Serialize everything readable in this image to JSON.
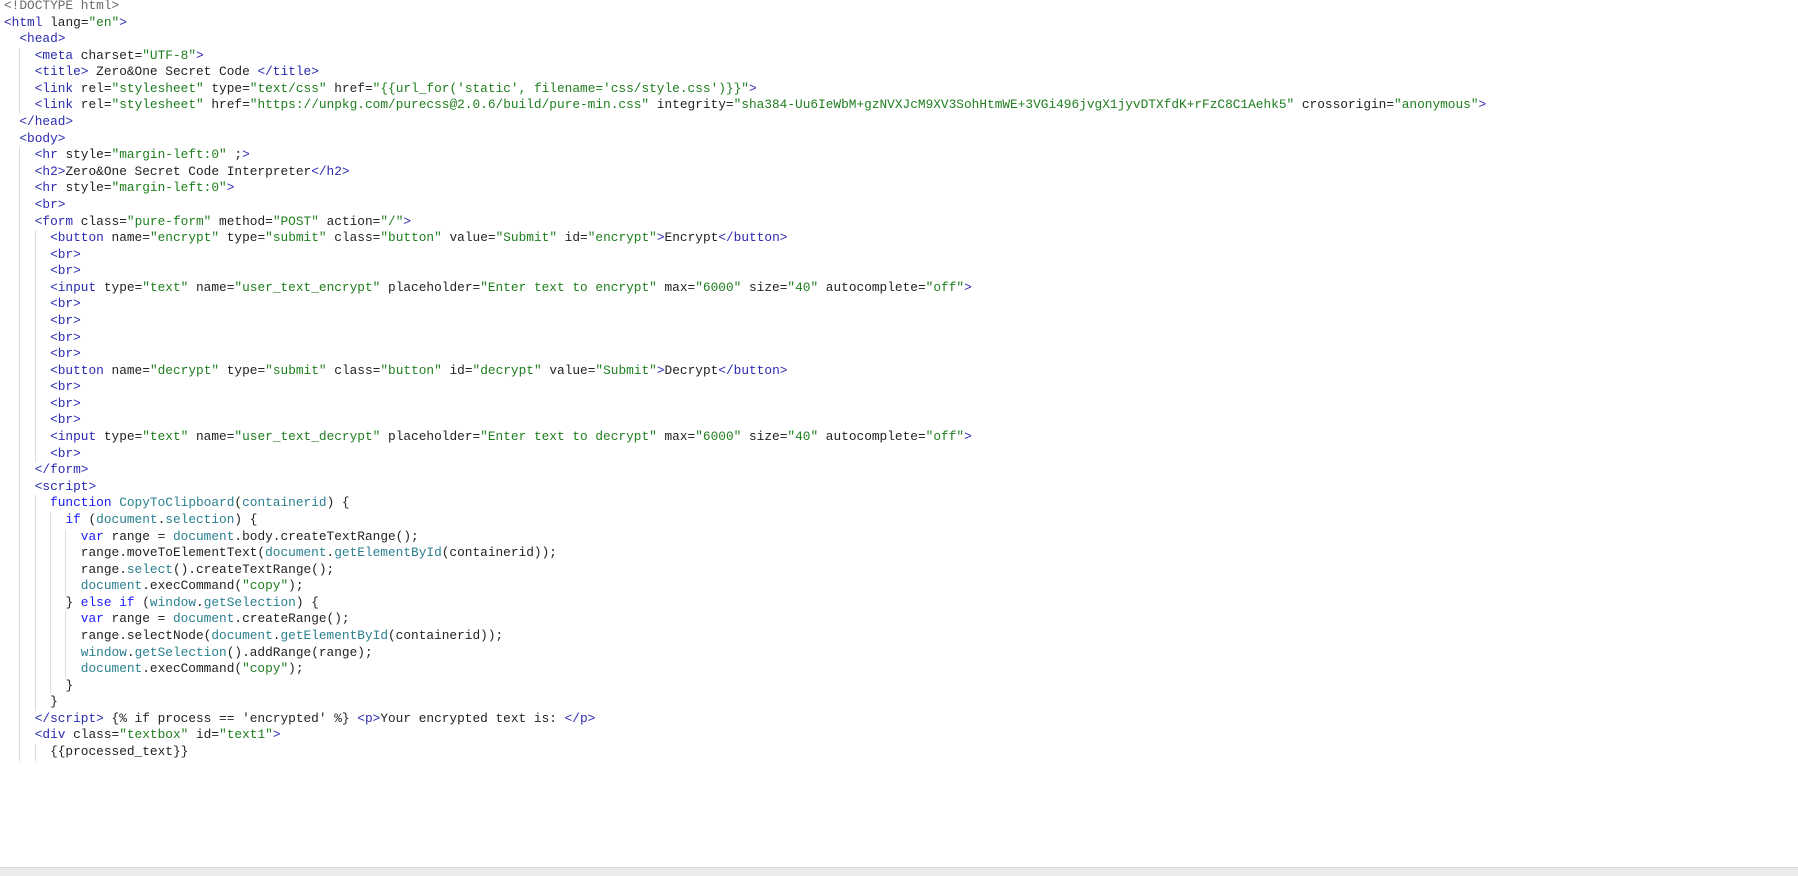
{
  "lines": [
    {
      "i": 0,
      "t": [
        [
          "dt",
          "<!DOCTYPE html>"
        ]
      ]
    },
    {
      "i": 0,
      "t": [
        [
          "p",
          "<html"
        ],
        [
          "a",
          " lang"
        ],
        [
          "x",
          "="
        ],
        [
          "s",
          "\"en\""
        ],
        [
          "p",
          ">"
        ]
      ]
    },
    {
      "i": 1,
      "t": [
        [
          "p",
          "<head>"
        ]
      ]
    },
    {
      "i": 2,
      "t": [
        [
          "p",
          "<meta"
        ],
        [
          "a",
          " charset"
        ],
        [
          "x",
          "="
        ],
        [
          "s",
          "\"UTF-8\""
        ],
        [
          "p",
          ">"
        ]
      ]
    },
    {
      "i": 2,
      "t": [
        [
          "p",
          "<title>"
        ],
        [
          "x",
          " Zero&One Secret Code "
        ],
        [
          "p",
          "</title>"
        ]
      ]
    },
    {
      "i": 2,
      "t": [
        [
          "p",
          "<link"
        ],
        [
          "a",
          " rel"
        ],
        [
          "x",
          "="
        ],
        [
          "s",
          "\"stylesheet\""
        ],
        [
          "a",
          " type"
        ],
        [
          "x",
          "="
        ],
        [
          "s",
          "\"text/css\""
        ],
        [
          "a",
          " href"
        ],
        [
          "x",
          "="
        ],
        [
          "s",
          "\"{{url_for('static', filename='css/style.css')}}\""
        ],
        [
          "p",
          ">"
        ]
      ]
    },
    {
      "i": 2,
      "t": [
        [
          "p",
          "<link"
        ],
        [
          "a",
          " rel"
        ],
        [
          "x",
          "="
        ],
        [
          "s",
          "\"stylesheet\""
        ],
        [
          "a",
          " href"
        ],
        [
          "x",
          "="
        ],
        [
          "s",
          "\"https://unpkg.com/purecss@2.0.6/build/pure-min.css\""
        ],
        [
          "a",
          " integrity"
        ],
        [
          "x",
          "="
        ],
        [
          "s",
          "\"sha384-Uu6IeWbM+gzNVXJcM9XV3SohHtmWE+3VGi496jvgX1jyvDTXfdK+rFzC8C1Aehk5\""
        ],
        [
          "a",
          " crossorigin"
        ],
        [
          "x",
          "="
        ],
        [
          "s",
          "\"anonymous\""
        ],
        [
          "p",
          ">"
        ]
      ]
    },
    {
      "i": 1,
      "t": [
        [
          "p",
          "</head>"
        ]
      ]
    },
    {
      "i": 1,
      "t": [
        [
          "p",
          "<body>"
        ]
      ]
    },
    {
      "i": 2,
      "t": [
        [
          "p",
          "<hr"
        ],
        [
          "a",
          " style"
        ],
        [
          "x",
          "="
        ],
        [
          "s",
          "\"margin-left:0\""
        ],
        [
          "a",
          " ;"
        ],
        [
          "p",
          ">"
        ]
      ]
    },
    {
      "i": 2,
      "t": [
        [
          "p",
          "<h2>"
        ],
        [
          "x",
          "Zero&One Secret Code Interpreter"
        ],
        [
          "p",
          "</h2>"
        ]
      ]
    },
    {
      "i": 2,
      "t": [
        [
          "p",
          "<hr"
        ],
        [
          "a",
          " style"
        ],
        [
          "x",
          "="
        ],
        [
          "s",
          "\"margin-left:0\""
        ],
        [
          "p",
          ">"
        ]
      ]
    },
    {
      "i": 2,
      "t": [
        [
          "p",
          "<br>"
        ]
      ]
    },
    {
      "i": 2,
      "t": [
        [
          "p",
          "<form"
        ],
        [
          "a",
          " class"
        ],
        [
          "x",
          "="
        ],
        [
          "s",
          "\"pure-form\""
        ],
        [
          "a",
          " method"
        ],
        [
          "x",
          "="
        ],
        [
          "s",
          "\"POST\""
        ],
        [
          "a",
          " action"
        ],
        [
          "x",
          "="
        ],
        [
          "s",
          "\"/\""
        ],
        [
          "p",
          ">"
        ]
      ]
    },
    {
      "i": 3,
      "t": [
        [
          "p",
          "<button"
        ],
        [
          "a",
          " name"
        ],
        [
          "x",
          "="
        ],
        [
          "s",
          "\"encrypt\""
        ],
        [
          "a",
          " type"
        ],
        [
          "x",
          "="
        ],
        [
          "s",
          "\"submit\""
        ],
        [
          "a",
          " class"
        ],
        [
          "x",
          "="
        ],
        [
          "s",
          "\"button\""
        ],
        [
          "a",
          " value"
        ],
        [
          "x",
          "="
        ],
        [
          "s",
          "\"Submit\""
        ],
        [
          "a",
          " id"
        ],
        [
          "x",
          "="
        ],
        [
          "s",
          "\"encrypt\""
        ],
        [
          "p",
          ">"
        ],
        [
          "x",
          "Encrypt"
        ],
        [
          "p",
          "</button>"
        ]
      ]
    },
    {
      "i": 3,
      "t": [
        [
          "p",
          "<br>"
        ]
      ]
    },
    {
      "i": 3,
      "t": [
        [
          "p",
          "<br>"
        ]
      ]
    },
    {
      "i": 3,
      "t": [
        [
          "p",
          "<input"
        ],
        [
          "a",
          " type"
        ],
        [
          "x",
          "="
        ],
        [
          "s",
          "\"text\""
        ],
        [
          "a",
          " name"
        ],
        [
          "x",
          "="
        ],
        [
          "s",
          "\"user_text_encrypt\""
        ],
        [
          "a",
          " placeholder"
        ],
        [
          "x",
          "="
        ],
        [
          "s",
          "\"Enter text to encrypt\""
        ],
        [
          "a",
          " max"
        ],
        [
          "x",
          "="
        ],
        [
          "s",
          "\"6000\""
        ],
        [
          "a",
          " size"
        ],
        [
          "x",
          "="
        ],
        [
          "s",
          "\"40\""
        ],
        [
          "a",
          " autocomplete"
        ],
        [
          "x",
          "="
        ],
        [
          "s",
          "\"off\""
        ],
        [
          "p",
          ">"
        ]
      ]
    },
    {
      "i": 3,
      "t": [
        [
          "p",
          "<br>"
        ]
      ]
    },
    {
      "i": 3,
      "t": [
        [
          "p",
          "<br>"
        ]
      ]
    },
    {
      "i": 3,
      "t": [
        [
          "p",
          "<br>"
        ]
      ]
    },
    {
      "i": 3,
      "t": [
        [
          "p",
          "<br>"
        ]
      ]
    },
    {
      "i": 3,
      "t": [
        [
          "p",
          "<button"
        ],
        [
          "a",
          " name"
        ],
        [
          "x",
          "="
        ],
        [
          "s",
          "\"decrypt\""
        ],
        [
          "a",
          " type"
        ],
        [
          "x",
          "="
        ],
        [
          "s",
          "\"submit\""
        ],
        [
          "a",
          " class"
        ],
        [
          "x",
          "="
        ],
        [
          "s",
          "\"button\""
        ],
        [
          "a",
          " id"
        ],
        [
          "x",
          "="
        ],
        [
          "s",
          "\"decrypt\""
        ],
        [
          "a",
          " value"
        ],
        [
          "x",
          "="
        ],
        [
          "s",
          "\"Submit\""
        ],
        [
          "p",
          ">"
        ],
        [
          "x",
          "Decrypt"
        ],
        [
          "p",
          "</button>"
        ]
      ]
    },
    {
      "i": 3,
      "t": [
        [
          "p",
          "<br>"
        ]
      ]
    },
    {
      "i": 3,
      "t": [
        [
          "p",
          "<br>"
        ]
      ]
    },
    {
      "i": 3,
      "t": [
        [
          "p",
          "<br>"
        ]
      ]
    },
    {
      "i": 3,
      "t": [
        [
          "p",
          "<input"
        ],
        [
          "a",
          " type"
        ],
        [
          "x",
          "="
        ],
        [
          "s",
          "\"text\""
        ],
        [
          "a",
          " name"
        ],
        [
          "x",
          "="
        ],
        [
          "s",
          "\"user_text_decrypt\""
        ],
        [
          "a",
          " placeholder"
        ],
        [
          "x",
          "="
        ],
        [
          "s",
          "\"Enter text to decrypt\""
        ],
        [
          "a",
          " max"
        ],
        [
          "x",
          "="
        ],
        [
          "s",
          "\"6000\""
        ],
        [
          "a",
          " size"
        ],
        [
          "x",
          "="
        ],
        [
          "s",
          "\"40\""
        ],
        [
          "a",
          " autocomplete"
        ],
        [
          "x",
          "="
        ],
        [
          "s",
          "\"off\""
        ],
        [
          "p",
          ">"
        ]
      ]
    },
    {
      "i": 3,
      "t": [
        [
          "p",
          "<br>"
        ]
      ]
    },
    {
      "i": 2,
      "t": [
        [
          "p",
          "</form>"
        ]
      ]
    },
    {
      "i": 2,
      "t": [
        [
          "p",
          "<script>"
        ]
      ]
    },
    {
      "i": 3,
      "t": [
        [
          "k",
          "function"
        ],
        [
          "x",
          " "
        ],
        [
          "o",
          "CopyToClipboard"
        ],
        [
          "x",
          "("
        ],
        [
          "o",
          "containerid"
        ],
        [
          "x",
          ") {"
        ]
      ]
    },
    {
      "i": 4,
      "t": [
        [
          "k",
          "if"
        ],
        [
          "x",
          " ("
        ],
        [
          "o",
          "document"
        ],
        [
          "x",
          "."
        ],
        [
          "o",
          "selection"
        ],
        [
          "x",
          ") {"
        ]
      ]
    },
    {
      "i": 5,
      "t": [
        [
          "k",
          "var"
        ],
        [
          "x",
          " range = "
        ],
        [
          "o",
          "document"
        ],
        [
          "x",
          ".body.createTextRange();"
        ]
      ]
    },
    {
      "i": 5,
      "t": [
        [
          "x",
          "range.moveToElementText("
        ],
        [
          "o",
          "document"
        ],
        [
          "x",
          "."
        ],
        [
          "o",
          "getElementById"
        ],
        [
          "x",
          "(containerid));"
        ]
      ]
    },
    {
      "i": 5,
      "t": [
        [
          "x",
          "range."
        ],
        [
          "o",
          "select"
        ],
        [
          "x",
          "().createTextRange();"
        ]
      ]
    },
    {
      "i": 5,
      "t": [
        [
          "o",
          "document"
        ],
        [
          "x",
          ".execCommand("
        ],
        [
          "s",
          "\"copy\""
        ],
        [
          "x",
          ");"
        ]
      ]
    },
    {
      "i": 4,
      "t": [
        [
          "x",
          "} "
        ],
        [
          "k",
          "else if"
        ],
        [
          "x",
          " ("
        ],
        [
          "o",
          "window"
        ],
        [
          "x",
          "."
        ],
        [
          "o",
          "getSelection"
        ],
        [
          "x",
          ") {"
        ]
      ]
    },
    {
      "i": 5,
      "t": [
        [
          "k",
          "var"
        ],
        [
          "x",
          " range = "
        ],
        [
          "o",
          "document"
        ],
        [
          "x",
          ".createRange();"
        ]
      ]
    },
    {
      "i": 5,
      "t": [
        [
          "x",
          "range.selectNode("
        ],
        [
          "o",
          "document"
        ],
        [
          "x",
          "."
        ],
        [
          "o",
          "getElementById"
        ],
        [
          "x",
          "(containerid));"
        ]
      ]
    },
    {
      "i": 5,
      "t": [
        [
          "o",
          "window"
        ],
        [
          "x",
          "."
        ],
        [
          "o",
          "getSelection"
        ],
        [
          "x",
          "().addRange(range);"
        ]
      ]
    },
    {
      "i": 5,
      "t": [
        [
          "o",
          "document"
        ],
        [
          "x",
          ".execCommand("
        ],
        [
          "s",
          "\"copy\""
        ],
        [
          "x",
          ");"
        ]
      ]
    },
    {
      "i": 4,
      "t": [
        [
          "x",
          "}"
        ]
      ]
    },
    {
      "i": 3,
      "t": [
        [
          "x",
          "}"
        ]
      ]
    },
    {
      "i": 2,
      "t": [
        [
          "p",
          "</script>"
        ],
        [
          "x",
          " {% if process == 'encrypted' %} "
        ],
        [
          "p",
          "<p>"
        ],
        [
          "x",
          "Your encrypted text is: "
        ],
        [
          "p",
          "</p>"
        ]
      ]
    },
    {
      "i": 2,
      "t": [
        [
          "p",
          "<div"
        ],
        [
          "a",
          " class"
        ],
        [
          "x",
          "="
        ],
        [
          "s",
          "\"textbox\""
        ],
        [
          "a",
          " id"
        ],
        [
          "x",
          "="
        ],
        [
          "s",
          "\"text1\""
        ],
        [
          "p",
          ">"
        ]
      ]
    },
    {
      "i": 3,
      "t": [
        [
          "x",
          "{{processed_text}}"
        ]
      ]
    }
  ]
}
